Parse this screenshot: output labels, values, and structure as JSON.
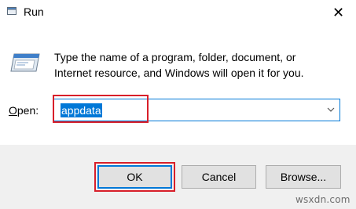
{
  "window": {
    "title": "Run",
    "close_symbol": "✕"
  },
  "icons": {
    "title": "run-app-icon",
    "dialog": "run-dialog-icon",
    "close": "close-icon",
    "dropdown": "chevron-down-icon"
  },
  "dialog": {
    "description_line1": "Type the name of a program, folder, document, or",
    "description_line2": "Internet resource, and Windows will open it for you.",
    "open_label_accel": "O",
    "open_label_rest": "pen:",
    "open_value": "appdata"
  },
  "buttons": {
    "ok": "OK",
    "cancel": "Cancel",
    "browse": "Browse..."
  },
  "watermark": "wsxdn.com",
  "colors": {
    "accent": "#0078d7",
    "highlight": "#d81f2a",
    "panel": "#ffffff",
    "background": "#f0f0f0",
    "button_face": "#e1e1e1"
  }
}
